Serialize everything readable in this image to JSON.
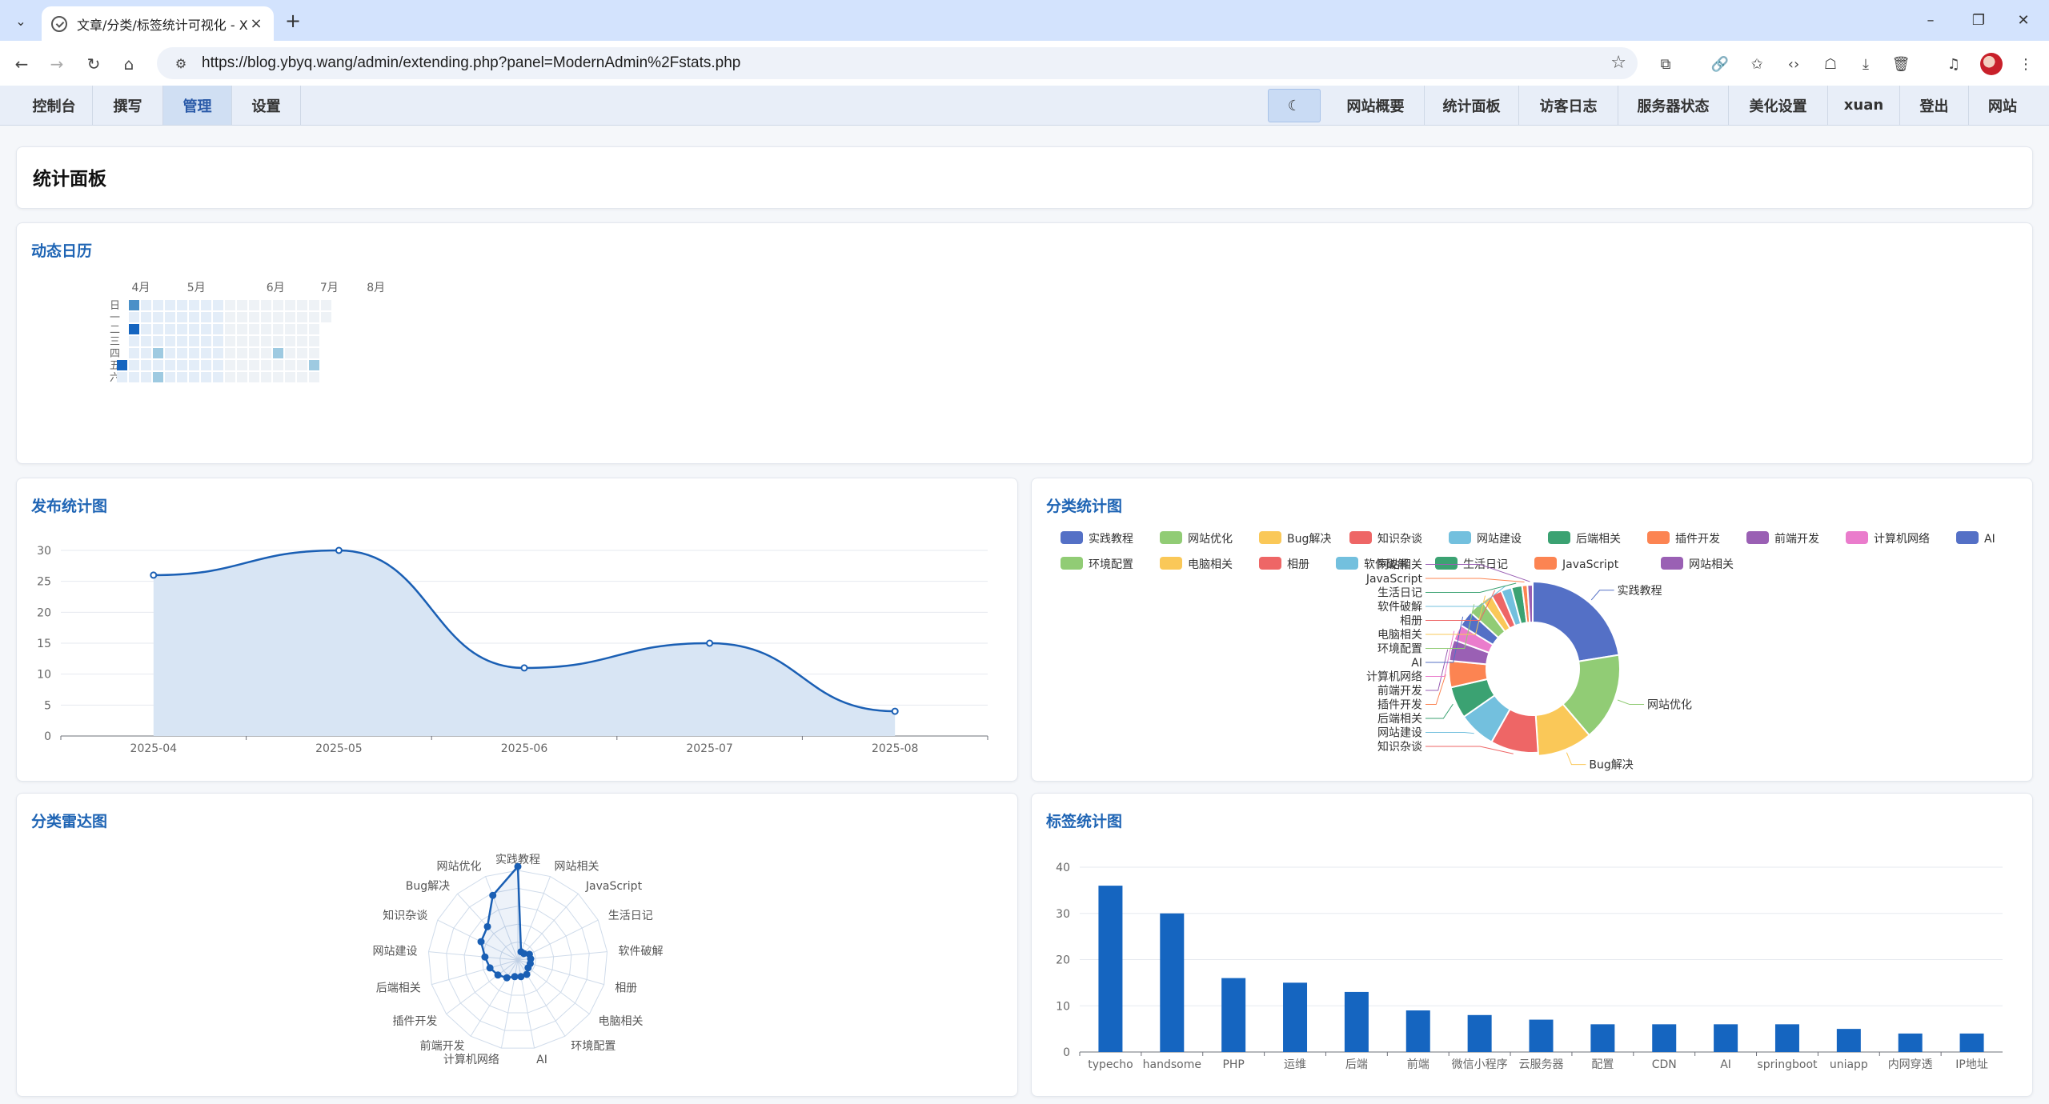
{
  "browser": {
    "tab_title": "文章/分类/标签统计可视化 - X",
    "url": "https://blog.ybyq.wang/admin/extending.php?panel=ModernAdmin%2Fstats.php"
  },
  "menu": {
    "left": [
      "控制台",
      "撰写",
      "管理",
      "设置"
    ],
    "active": "管理",
    "moon_icon": "☾",
    "right": [
      "网站概要",
      "统计面板",
      "访客日志",
      "服务器状态",
      "美化设置",
      "xuan",
      "登出",
      "网站"
    ]
  },
  "page": {
    "title": "统计面板",
    "calendar_title": "动态日历",
    "publish_title": "发布统计图",
    "category_title": "分类统计图",
    "radar_title": "分类雷达图",
    "tag_title": "标签统计图"
  },
  "colors": {
    "accent": "#1e64b4",
    "line": "#1a5fb4",
    "palette": [
      "#5470c6",
      "#91cc75",
      "#fac858",
      "#ee6666",
      "#73c0de",
      "#3ba272",
      "#fc8452",
      "#9a60b4",
      "#ea7ccc"
    ]
  },
  "chart_data": [
    {
      "type": "heatmap",
      "title": "动态日历",
      "month_labels": [
        "4月",
        "5月",
        "6月",
        "7月",
        "8月"
      ],
      "weekday_labels": [
        "日",
        "一",
        "二",
        "三",
        "四",
        "五",
        "六"
      ],
      "weeks": 18,
      "active_cells": [
        {
          "week": 1,
          "day": 0,
          "level": 3
        },
        {
          "week": 1,
          "day": 2,
          "level": 4
        },
        {
          "week": 0,
          "day": 5,
          "level": 4
        },
        {
          "week": 3,
          "day": 4,
          "level": 2
        },
        {
          "week": 3,
          "day": 6,
          "level": 2
        },
        {
          "week": 13,
          "day": 4,
          "level": 2
        },
        {
          "week": 16,
          "day": 5,
          "level": 2
        }
      ]
    },
    {
      "type": "area",
      "title": "发布统计图",
      "x": [
        "2025-04",
        "2025-05",
        "2025-06",
        "2025-07",
        "2025-08"
      ],
      "values": [
        26,
        30,
        11,
        15,
        4
      ],
      "ylim": [
        0,
        30
      ],
      "yticks": [
        0,
        5,
        10,
        15,
        20,
        25,
        30
      ]
    },
    {
      "type": "pie",
      "title": "分类统计图",
      "legend_position": "top",
      "categories": [
        "实践教程",
        "网站优化",
        "Bug解决",
        "知识杂谈",
        "网站建设",
        "后端相关",
        "插件开发",
        "前端开发",
        "计算机网络",
        "AI",
        "环境配置",
        "电脑相关",
        "相册",
        "软件破解",
        "生活日记",
        "JavaScript",
        "网站相关"
      ],
      "values": [
        22,
        16,
        10,
        9,
        7,
        6,
        5,
        4,
        3,
        3,
        3,
        2,
        2,
        2,
        2,
        1,
        1
      ]
    },
    {
      "type": "radar",
      "title": "分类雷达图",
      "indicators": [
        "实践教程",
        "网站相关",
        "JavaScript",
        "生活日记",
        "软件破解",
        "相册",
        "电脑相关",
        "环境配置",
        "AI",
        "计算机网络",
        "前端开发",
        "插件开发",
        "后端相关",
        "网站建设",
        "知识杂谈",
        "Bug解决",
        "网站优化"
      ],
      "values": [
        22,
        1,
        1,
        2,
        2,
        2,
        2,
        3,
        3,
        3,
        4,
        5,
        6,
        7,
        9,
        10,
        16
      ],
      "max": 22
    },
    {
      "type": "bar",
      "title": "标签统计图",
      "categories": [
        "typecho",
        "handsome",
        "PHP",
        "运维",
        "后端",
        "前端",
        "微信小程序",
        "云服务器",
        "配置",
        "CDN",
        "AI",
        "springboot",
        "uniapp",
        "内网穿透",
        "IP地址"
      ],
      "values": [
        36,
        30,
        16,
        15,
        13,
        9,
        8,
        7,
        6,
        6,
        6,
        6,
        5,
        4,
        4
      ],
      "ylim": [
        0,
        40
      ],
      "yticks": [
        0,
        10,
        20,
        30,
        40
      ]
    }
  ]
}
